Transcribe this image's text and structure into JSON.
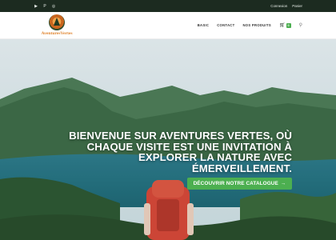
{
  "topbar": {
    "social_icons": [
      "youtube-icon",
      "pinterest-icon",
      "instagram-icon"
    ],
    "links": [
      "Connexion",
      "Panier"
    ]
  },
  "header": {
    "logo_text": "AventuresVertes",
    "nav": [
      "BASIC",
      "CONTACT",
      "NOS PRODUITS"
    ],
    "cart_count": "0",
    "colors": {
      "accent": "#4caf50",
      "topbar": "#1c2b20",
      "logo": "#e0832c"
    }
  },
  "hero": {
    "title": "BIENVENUE SUR AVENTURES VERTES, OÙ CHAQUE VISITE EST UNE INVITATION À EXPLORER LA NATURE AVEC ÉMERVEILLEMENT.",
    "cta_label": "DÉCOUVRIR NOTRE CATALOGUE",
    "cta_icon": "arrow-right-icon"
  }
}
